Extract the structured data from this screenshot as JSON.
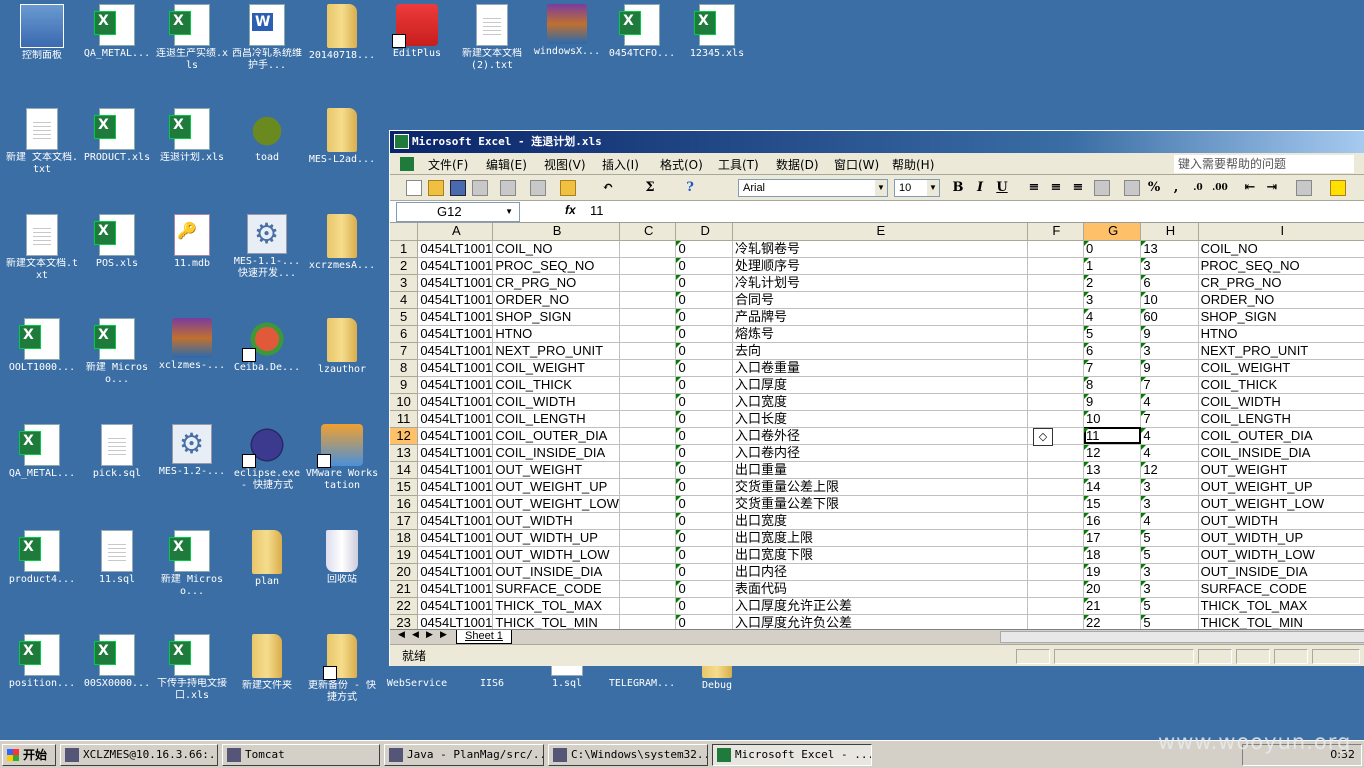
{
  "desktop_icons": [
    {
      "label": "控制面板",
      "type": "panel"
    },
    {
      "label": "QA_METAL...",
      "type": "xls"
    },
    {
      "label": "连退生产实绩.xls",
      "type": "xls"
    },
    {
      "label": "西昌冷轧系统维护手...",
      "type": "doc"
    },
    {
      "label": "20140718...",
      "type": "folder"
    },
    {
      "label": "EditPlus",
      "type": "app red shortcut"
    },
    {
      "label": "新建文本文档 (2).txt",
      "type": "txt"
    },
    {
      "label": "windowsX...",
      "type": "rar"
    },
    {
      "label": "0454TCFO...",
      "type": "xls"
    },
    {
      "label": "12345.xls",
      "type": "xls"
    },
    {
      "label": "新建 文本文档.txt",
      "type": "txt"
    },
    {
      "label": "PRODUCT.xls",
      "type": "xls"
    },
    {
      "label": "连退计划.xls",
      "type": "xls"
    },
    {
      "label": "toad",
      "type": "app toad"
    },
    {
      "label": "MES-L2ad...",
      "type": "folder"
    },
    {
      "label": "新建文本文档.txt",
      "type": "txt"
    },
    {
      "label": "POS.xls",
      "type": "xls"
    },
    {
      "label": "11.mdb",
      "type": "mdb"
    },
    {
      "label": "MES-1.1-...快速开发...",
      "type": "gear"
    },
    {
      "label": "xcrzmesA...",
      "type": "folder"
    },
    {
      "label": "OOLT1000...",
      "type": "xls"
    },
    {
      "label": "新建 Microso...",
      "type": "xls"
    },
    {
      "label": "xclzmes-...",
      "type": "rar"
    },
    {
      "label": "Ceiba.De...",
      "type": "app ceiba shortcut"
    },
    {
      "label": "lzauthor",
      "type": "folder"
    },
    {
      "label": "QA_METAL...",
      "type": "xls"
    },
    {
      "label": "pick.sql",
      "type": "txt"
    },
    {
      "label": "MES-1.2-...",
      "type": "gear"
    },
    {
      "label": "eclipse.exe - 快捷方式",
      "type": "app eclipse shortcut"
    },
    {
      "label": "VMware Workstation",
      "type": "app vmware shortcut"
    },
    {
      "label": "product4...",
      "type": "xls"
    },
    {
      "label": "11.sql",
      "type": "txt"
    },
    {
      "label": "新建 Microso...",
      "type": "xls"
    },
    {
      "label": "plan",
      "type": "folder"
    },
    {
      "label": "回收站",
      "type": "recycle"
    },
    {
      "label": "position...",
      "type": "xls"
    },
    {
      "label": "00SX0000...",
      "type": "xls"
    },
    {
      "label": "下传手持电文接口.xls",
      "type": "xls"
    },
    {
      "label": "新建文件夹",
      "type": "folder"
    },
    {
      "label": "更新备份 - 快捷方式",
      "type": "folder shortcut"
    },
    {
      "label": "WebService",
      "type": "app"
    },
    {
      "label": "IIS6",
      "type": "app"
    },
    {
      "label": "1.sql",
      "type": "txt"
    },
    {
      "label": "TELEGRAM...",
      "type": "app"
    },
    {
      "label": "Debug",
      "type": "folder"
    }
  ],
  "excel": {
    "title": "Microsoft Excel - 连退计划.xls",
    "menu": [
      "文件(F)",
      "编辑(E)",
      "视图(V)",
      "插入(I)",
      "格式(O)",
      "工具(T)",
      "数据(D)",
      "窗口(W)",
      "帮助(H)"
    ],
    "help_placeholder": "键入需要帮助的问题",
    "font_name": "Arial",
    "font_size": "10",
    "name_box": "G12",
    "fx_label": "fx",
    "formula_value": "11",
    "columns": [
      "A",
      "B",
      "C",
      "D",
      "E",
      "F",
      "G",
      "H",
      "I"
    ],
    "selected_column": "G",
    "selected_row": "12",
    "rows": [
      {
        "n": "1",
        "a": "0454LT1001",
        "b": "COIL_NO",
        "d": "0",
        "e": "冷轧钢卷号",
        "g": "0",
        "h": "13",
        "i": "COIL_NO"
      },
      {
        "n": "2",
        "a": "0454LT1001",
        "b": "PROC_SEQ_NO",
        "d": "0",
        "e": "处理顺序号",
        "g": "1",
        "h": "3",
        "i": "PROC_SEQ_NO"
      },
      {
        "n": "3",
        "a": "0454LT1001",
        "b": "CR_PRG_NO",
        "d": "0",
        "e": "冷轧计划号",
        "g": "2",
        "h": "6",
        "i": "CR_PRG_NO"
      },
      {
        "n": "4",
        "a": "0454LT1001",
        "b": "ORDER_NO",
        "d": "0",
        "e": "合同号",
        "g": "3",
        "h": "10",
        "i": "ORDER_NO"
      },
      {
        "n": "5",
        "a": "0454LT1001",
        "b": "SHOP_SIGN",
        "d": "0",
        "e": "产品牌号",
        "g": "4",
        "h": "60",
        "i": "SHOP_SIGN"
      },
      {
        "n": "6",
        "a": "0454LT1001",
        "b": "HTNO",
        "d": "0",
        "e": "熔炼号",
        "g": "5",
        "h": "9",
        "i": "HTNO"
      },
      {
        "n": "7",
        "a": "0454LT1001",
        "b": "NEXT_PRO_UNIT",
        "d": "0",
        "e": "去向",
        "g": "6",
        "h": "3",
        "i": "NEXT_PRO_UNIT"
      },
      {
        "n": "8",
        "a": "0454LT1001",
        "b": "COIL_WEIGHT",
        "d": "0",
        "e": "入口卷重量",
        "g": "7",
        "h": "9",
        "i": "COIL_WEIGHT"
      },
      {
        "n": "9",
        "a": "0454LT1001",
        "b": "COIL_THICK",
        "d": "0",
        "e": "入口厚度",
        "g": "8",
        "h": "7",
        "i": "COIL_THICK"
      },
      {
        "n": "10",
        "a": "0454LT1001",
        "b": "COIL_WIDTH",
        "d": "0",
        "e": "入口宽度",
        "g": "9",
        "h": "4",
        "i": "COIL_WIDTH"
      },
      {
        "n": "11",
        "a": "0454LT1001",
        "b": "COIL_LENGTH",
        "d": "0",
        "e": "入口长度",
        "g": "10",
        "h": "7",
        "i": "COIL_LENGTH"
      },
      {
        "n": "12",
        "a": "0454LT1001",
        "b": "COIL_OUTER_DIA",
        "d": "0",
        "e": "入口卷外径",
        "g": "11",
        "h": "4",
        "i": "COIL_OUTER_DIA"
      },
      {
        "n": "13",
        "a": "0454LT1001",
        "b": "COIL_INSIDE_DIA",
        "d": "0",
        "e": "入口卷内径",
        "g": "12",
        "h": "4",
        "i": "COIL_INSIDE_DIA"
      },
      {
        "n": "14",
        "a": "0454LT1001",
        "b": "OUT_WEIGHT",
        "d": "0",
        "e": "出口重量",
        "g": "13",
        "h": "12",
        "i": "OUT_WEIGHT"
      },
      {
        "n": "15",
        "a": "0454LT1001",
        "b": "OUT_WEIGHT_UP",
        "d": "0",
        "e": "交货重量公差上限",
        "g": "14",
        "h": "3",
        "i": "OUT_WEIGHT_UP"
      },
      {
        "n": "16",
        "a": "0454LT1001",
        "b": "OUT_WEIGHT_LOW",
        "d": "0",
        "e": "交货重量公差下限",
        "g": "15",
        "h": "3",
        "i": "OUT_WEIGHT_LOW"
      },
      {
        "n": "17",
        "a": "0454LT1001",
        "b": "OUT_WIDTH",
        "d": "0",
        "e": "出口宽度",
        "g": "16",
        "h": "4",
        "i": "OUT_WIDTH"
      },
      {
        "n": "18",
        "a": "0454LT1001",
        "b": "OUT_WIDTH_UP",
        "d": "0",
        "e": "出口宽度上限",
        "g": "17",
        "h": "5",
        "i": "OUT_WIDTH_UP"
      },
      {
        "n": "19",
        "a": "0454LT1001",
        "b": "OUT_WIDTH_LOW",
        "d": "0",
        "e": "出口宽度下限",
        "g": "18",
        "h": "5",
        "i": "OUT_WIDTH_LOW"
      },
      {
        "n": "20",
        "a": "0454LT1001",
        "b": "OUT_INSIDE_DIA",
        "d": "0",
        "e": "出口内径",
        "g": "19",
        "h": "3",
        "i": "OUT_INSIDE_DIA"
      },
      {
        "n": "21",
        "a": "0454LT1001",
        "b": "SURFACE_CODE",
        "d": "0",
        "e": "表面代码",
        "g": "20",
        "h": "3",
        "i": "SURFACE_CODE"
      },
      {
        "n": "22",
        "a": "0454LT1001",
        "b": "THICK_TOL_MAX",
        "d": "0",
        "e": "入口厚度允许正公差",
        "g": "21",
        "h": "5",
        "i": "THICK_TOL_MAX"
      },
      {
        "n": "23",
        "a": "0454LT1001",
        "b": "THICK_TOL_MIN",
        "d": "0",
        "e": "入口厚度允许负公差",
        "g": "22",
        "h": "5",
        "i": "THICK_TOL_MIN"
      }
    ],
    "sheet_tab": "Sheet 1",
    "status": "就绪"
  },
  "taskbar": {
    "start": "开始",
    "tasks": [
      "XCLZMES@10.16.3.66:...",
      "Tomcat",
      "Java - PlanMag/src/...",
      "C:\\Windows\\system32...",
      "Microsoft Excel - ..."
    ],
    "clock": "0:32"
  },
  "watermark": "www.wooyun.org"
}
